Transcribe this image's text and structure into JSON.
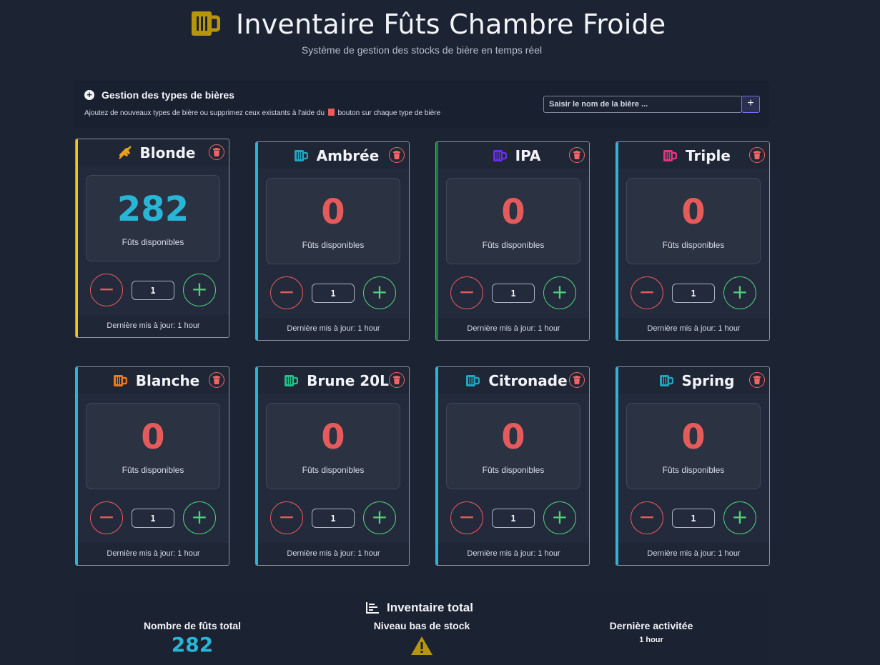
{
  "header": {
    "title": "Inventaire Fûts Chambre Froide",
    "subtitle": "Système de gestion des stocks de bière en temps réel",
    "logo_icon": "beer-mug-icon",
    "logo_color": "#b8960c"
  },
  "management": {
    "title": "Gestion des types de bières",
    "help_before": "Ajoutez de nouveaux types de bière ou supprimez ceux existants à l'aide du",
    "help_after": "bouton sur chaque type de bière",
    "input_placeholder": "Saisir le nom de la bière ...",
    "add_label": "+"
  },
  "card_labels": {
    "stock_label": "Fûts disponibles",
    "minus": "−",
    "plus": "+",
    "qty": "1",
    "last_update": "Dernière mis à jour: 1 hour"
  },
  "beers": [
    {
      "name": "Blonde",
      "count": "282",
      "icon": "wheat-icon",
      "icon_color": "#e8a21c",
      "accent": "#f5c518",
      "count_color": "#29b6d6"
    },
    {
      "name": "Ambrée",
      "count": "0",
      "icon": "beer-mug-icon",
      "icon_color": "#1fa6c0",
      "accent": "#29b6d6",
      "count_color": "#e55b5b"
    },
    {
      "name": "IPA",
      "count": "0",
      "icon": "beer-mug-icon",
      "icon_color": "#6a2ee8",
      "accent": "#1e7a3c",
      "count_color": "#e55b5b"
    },
    {
      "name": "Triple",
      "count": "0",
      "icon": "beer-mug-icon",
      "icon_color": "#e0357f",
      "accent": "#29b6d6",
      "count_color": "#e55b5b"
    },
    {
      "name": "Blanche",
      "count": "0",
      "icon": "beer-mug-icon",
      "icon_color": "#f07a1a",
      "accent": "#29b6d6",
      "count_color": "#e55b5b"
    },
    {
      "name": "Brune 20L",
      "count": "0",
      "icon": "beer-mug-icon",
      "icon_color": "#22c08a",
      "accent": "#29b6d6",
      "count_color": "#e55b5b"
    },
    {
      "name": "Citronade",
      "count": "0",
      "icon": "beer-mug-icon",
      "icon_color": "#1fa6c0",
      "accent": "#29b6d6",
      "count_color": "#e55b5b"
    },
    {
      "name": "Spring",
      "count": "0",
      "icon": "beer-mug-icon",
      "icon_color": "#1fa6c0",
      "accent": "#29b6d6",
      "count_color": "#e55b5b"
    }
  ],
  "summary": {
    "title": "Inventaire total",
    "total_label": "Nombre de fûts total",
    "total_value": "282",
    "low_stock_label": "Niveau bas de stock",
    "low_stock_icon": "warning-icon",
    "last_activity_label": "Dernière activitée",
    "last_activity_value": "1 hour"
  }
}
